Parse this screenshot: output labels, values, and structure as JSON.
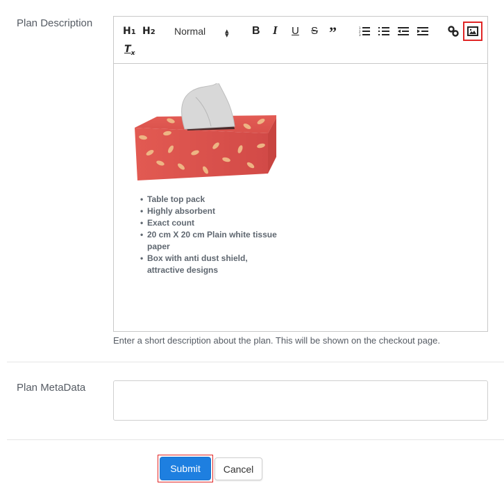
{
  "form": {
    "description": {
      "label": "Plan Description",
      "help_text": "Enter a short description about the plan. This will be shown on the checkout page.",
      "toolbar": {
        "h1": "H",
        "h1_sub": "1",
        "h2": "H",
        "h2_sub": "2",
        "format_select": "Normal",
        "format_arrow": "⬍",
        "bold": "B",
        "italic": "I",
        "underline": "U",
        "strike": "S",
        "blockquote": "”",
        "clear_format": "T",
        "clear_format_sub": "x",
        "highlighted_button": "image"
      },
      "content": {
        "image_alt": "Tissue box product image",
        "bullets": [
          "Table top pack",
          "Highly absorbent",
          "Exact count",
          "20 cm X 20 cm Plain white tissue paper",
          "Box with anti dust shield, attractive designs"
        ]
      }
    },
    "metadata": {
      "label": "Plan MetaData",
      "value": "",
      "placeholder": ""
    },
    "actions": {
      "submit_label": "Submit",
      "cancel_label": "Cancel"
    }
  },
  "colors": {
    "primary": "#1e7fe0",
    "highlight": "#e02424"
  }
}
